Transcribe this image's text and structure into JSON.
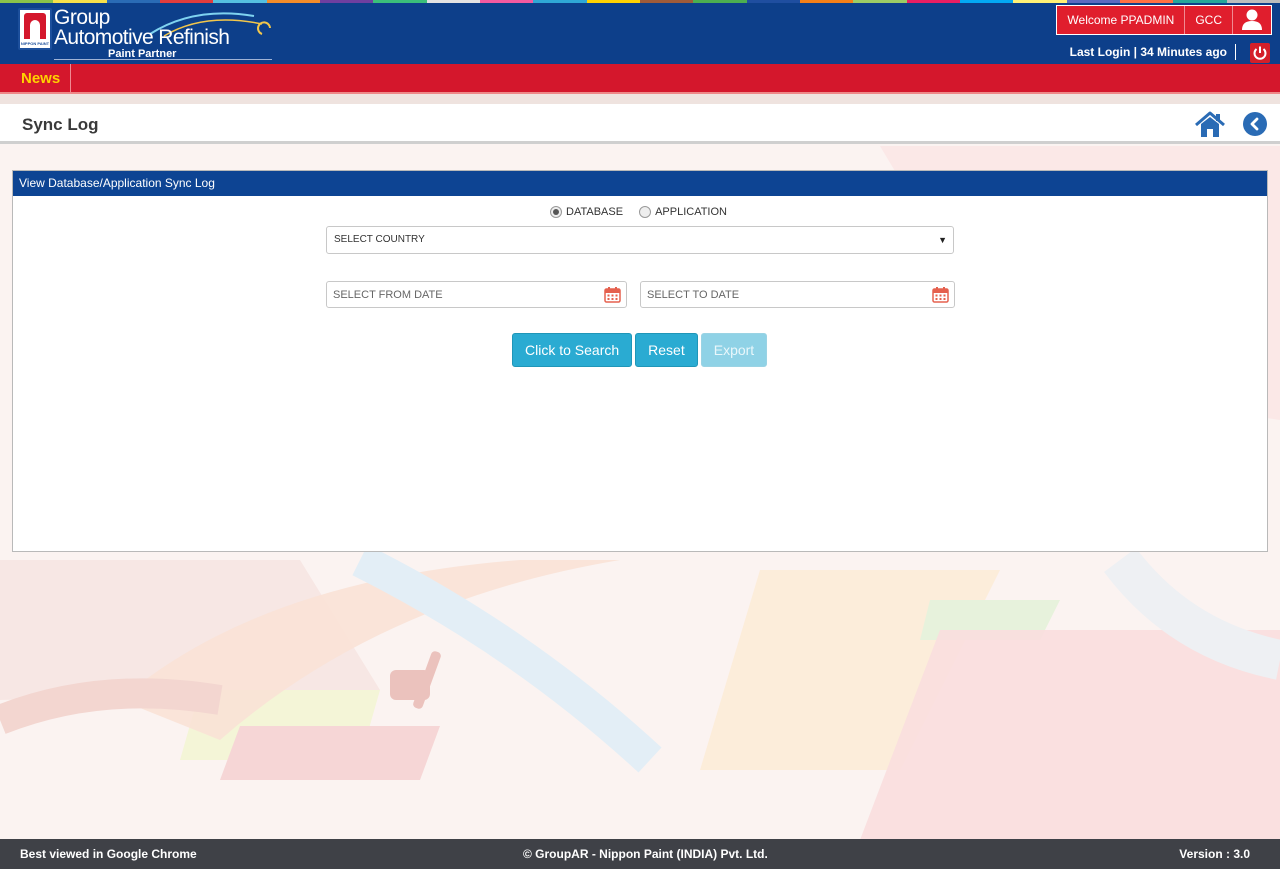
{
  "header": {
    "brand_line1": "Group",
    "brand_line2": "Automotive Refinish",
    "brand_line3": "Paint Partner",
    "logo_mark_text": "NIPPON PAINT",
    "welcome": "Welcome PPADMIN",
    "region": "GCC",
    "last_login": "Last Login | 34 Minutes ago",
    "user_icon": "user-icon",
    "power_icon": "power-icon"
  },
  "newsbar": {
    "label": "News"
  },
  "page": {
    "title": "Sync Log",
    "home_icon": "home-icon",
    "back_icon": "back-icon"
  },
  "panel": {
    "heading": "View Database/Application Sync Log",
    "radios": [
      {
        "label": "DATABASE",
        "checked": true
      },
      {
        "label": "APPLICATION",
        "checked": false
      }
    ],
    "country_select": {
      "value": "SELECT COUNTRY"
    },
    "from_date": {
      "placeholder": "SELECT FROM DATE"
    },
    "to_date": {
      "placeholder": "SELECT TO DATE"
    },
    "buttons": {
      "search": "Click to Search",
      "reset": "Reset",
      "export": "Export"
    }
  },
  "footer": {
    "left": "Best viewed in Google Chrome",
    "center": "© GroupAR - Nippon Paint (INDIA) Pvt. Ltd.",
    "right": "Version : 3.0"
  },
  "colors": {
    "header_blue": "#0d3f8a",
    "news_red": "#d4172c",
    "news_yellow": "#ffd200",
    "panel_head_blue": "#0d4493",
    "button_cyan": "#2aabd2",
    "footer_gray": "#3f4147"
  }
}
